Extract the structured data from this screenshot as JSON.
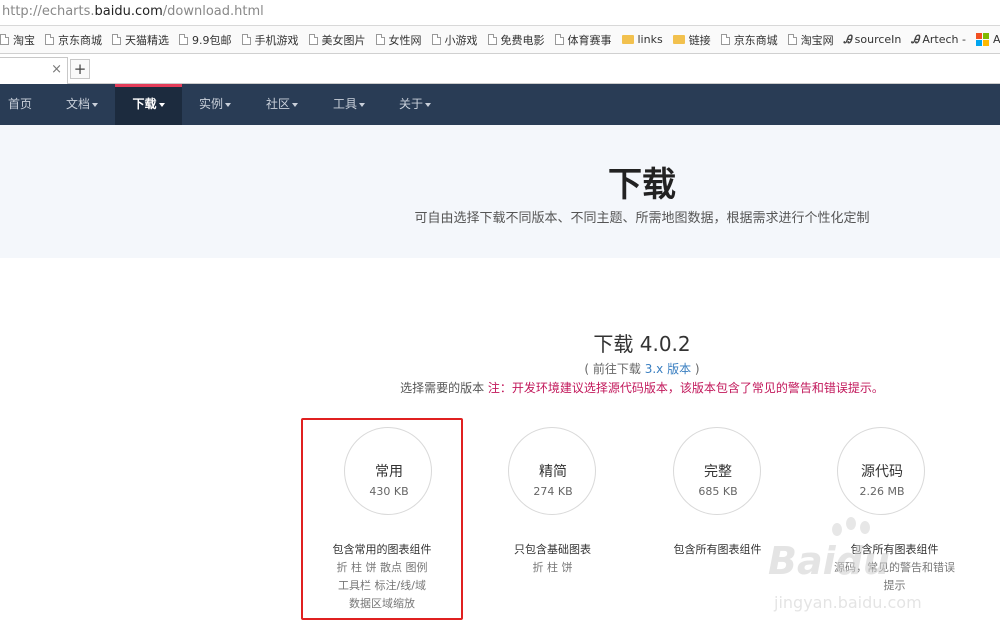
{
  "browser": {
    "url_prefix": "http://echarts.",
    "url_domain": "baidu.com",
    "url_path": "/download.html",
    "bookmarks": [
      {
        "label": "淘宝",
        "kind": "page"
      },
      {
        "label": "京东商城",
        "kind": "page"
      },
      {
        "label": "天猫精选",
        "kind": "page"
      },
      {
        "label": "9.9包邮",
        "kind": "page"
      },
      {
        "label": "手机游戏",
        "kind": "page"
      },
      {
        "label": "美女图片",
        "kind": "page"
      },
      {
        "label": "女性网",
        "kind": "page"
      },
      {
        "label": "小游戏",
        "kind": "page"
      },
      {
        "label": "免费电影",
        "kind": "page"
      },
      {
        "label": "体育赛事",
        "kind": "page"
      },
      {
        "label": "links",
        "kind": "folder"
      },
      {
        "label": "链接",
        "kind": "folder"
      },
      {
        "label": "京东商城",
        "kind": "page"
      },
      {
        "label": "淘宝网",
        "kind": "page"
      },
      {
        "label": "sourceIn",
        "kind": "artech"
      },
      {
        "label": "Artech -",
        "kind": "artech"
      },
      {
        "label": "ASP.NET",
        "kind": "asp"
      }
    ],
    "bookmarks_more": "»",
    "tab_close": "×",
    "new_tab": "+"
  },
  "nav": {
    "items": [
      "首页",
      "文档",
      "下载",
      "实例",
      "社区",
      "工具",
      "关于"
    ],
    "active": "下载"
  },
  "hero": {
    "title": "下载",
    "subtitle": "可自由选择下载不同版本、不同主题、所需地图数据，根据需求进行个性化定制"
  },
  "download": {
    "title": "下载 4.0.2",
    "prev_open": "( 前往下载 ",
    "prev_link": "3.x 版本",
    "prev_close": " )",
    "note_label": "选择需要的版本",
    "note_warning": "注：开发环境建议选择源代码版本，该版本包含了常见的警告和错误提示。",
    "packages": [
      {
        "name": "常用",
        "size": "430 KB",
        "desc": "包含常用的图表组件",
        "detail": [
          "折 柱 饼 散点 图例",
          "工具栏 标注/线/域",
          "数据区域缩放"
        ]
      },
      {
        "name": "精简",
        "size": "274 KB",
        "desc": "只包含基础图表",
        "detail": [
          "折 柱 饼"
        ]
      },
      {
        "name": "完整",
        "size": "685 KB",
        "desc": "包含所有图表组件",
        "detail": []
      },
      {
        "name": "源代码",
        "size": "2.26 MB",
        "desc": "包含所有图表组件",
        "detail": [
          "源码，常见的警告和错误",
          "提示"
        ]
      }
    ]
  },
  "watermark": {
    "logo": "Baidu",
    "url": "jingyan.baidu.com"
  },
  "colors": {
    "nav_bg": "#293c55",
    "nav_active": "#1c2b3e",
    "accent": "#e43c59",
    "highlight": "#e02020",
    "warning": "#c2185b",
    "link": "#3a7fc1"
  }
}
